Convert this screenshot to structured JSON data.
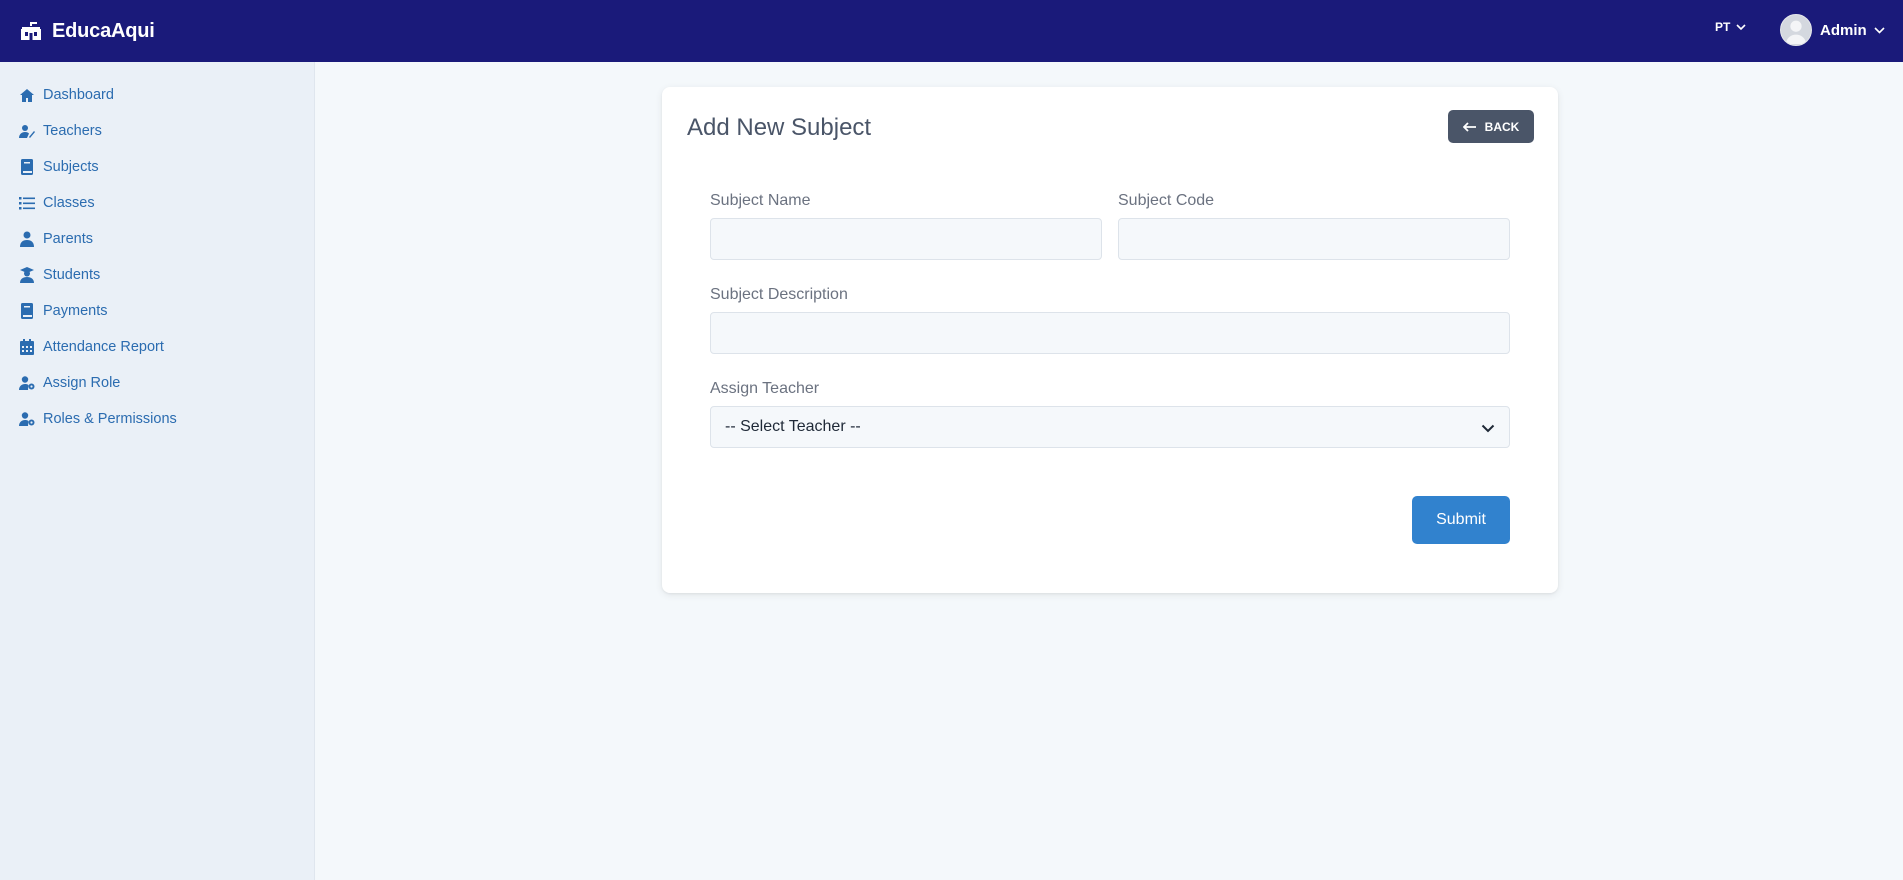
{
  "app": {
    "name": "EducaAqui",
    "logo_icon": "school-icon"
  },
  "header": {
    "language": "PT",
    "user_name": "Admin"
  },
  "sidebar": {
    "items": [
      {
        "label": "Dashboard",
        "icon": "home-icon"
      },
      {
        "label": "Teachers",
        "icon": "teacher-icon"
      },
      {
        "label": "Subjects",
        "icon": "book-icon"
      },
      {
        "label": "Classes",
        "icon": "list-icon"
      },
      {
        "label": "Parents",
        "icon": "person-icon"
      },
      {
        "label": "Students",
        "icon": "graduate-icon"
      },
      {
        "label": "Payments",
        "icon": "book-icon"
      },
      {
        "label": "Attendance Report",
        "icon": "calendar-icon"
      },
      {
        "label": "Assign Role",
        "icon": "user-cog-icon"
      },
      {
        "label": "Roles & Permissions",
        "icon": "user-cog-icon"
      }
    ]
  },
  "form": {
    "title": "Add New Subject",
    "back_label": "BACK",
    "subject_name_label": "Subject Name",
    "subject_name_value": "",
    "subject_code_label": "Subject Code",
    "subject_code_value": "",
    "subject_description_label": "Subject Description",
    "subject_description_value": "",
    "assign_teacher_label": "Assign Teacher",
    "assign_teacher_selected": "-- Select Teacher --",
    "submit_label": "Submit"
  },
  "colors": {
    "topbar": "#1a1a7a",
    "sidebar_bg": "#eaf0f7",
    "link": "#2b6cb0",
    "back_button": "#4a5568",
    "submit_button": "#3182ce"
  }
}
